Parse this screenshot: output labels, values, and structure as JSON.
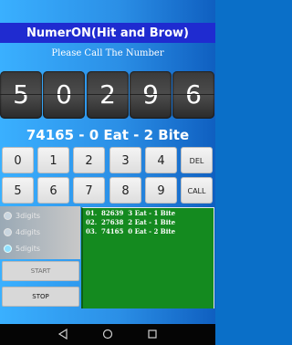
{
  "title": "NumerON(Hit and Brow)",
  "subtitle": "Please Call The Number",
  "digits": [
    "5",
    "0",
    "2",
    "9",
    "6"
  ],
  "result": "74165 - 0 Eat - 2 Bite",
  "keypad": {
    "row1": [
      "0",
      "1",
      "2",
      "3",
      "4",
      "DEL"
    ],
    "row2": [
      "5",
      "6",
      "7",
      "8",
      "9",
      "CALL"
    ]
  },
  "options": {
    "items": [
      {
        "label": "3digits",
        "selected": false
      },
      {
        "label": "4digits",
        "selected": false
      },
      {
        "label": "5digits",
        "selected": true
      }
    ]
  },
  "controls": {
    "start": "START",
    "stop": "STOP"
  },
  "log": [
    "01.  82639  3 Eat - 1 Bite",
    "02.  27638  2 Eat - 1 Bite",
    "03.  74165  0 Eat - 2 Bite"
  ],
  "navbar": {
    "back": "back-icon",
    "home": "home-icon",
    "recents": "recents-icon"
  },
  "colors": {
    "title_bar": "#1f2bd0",
    "log_bg": "#148a1f",
    "accent": "#2b8fe6"
  }
}
